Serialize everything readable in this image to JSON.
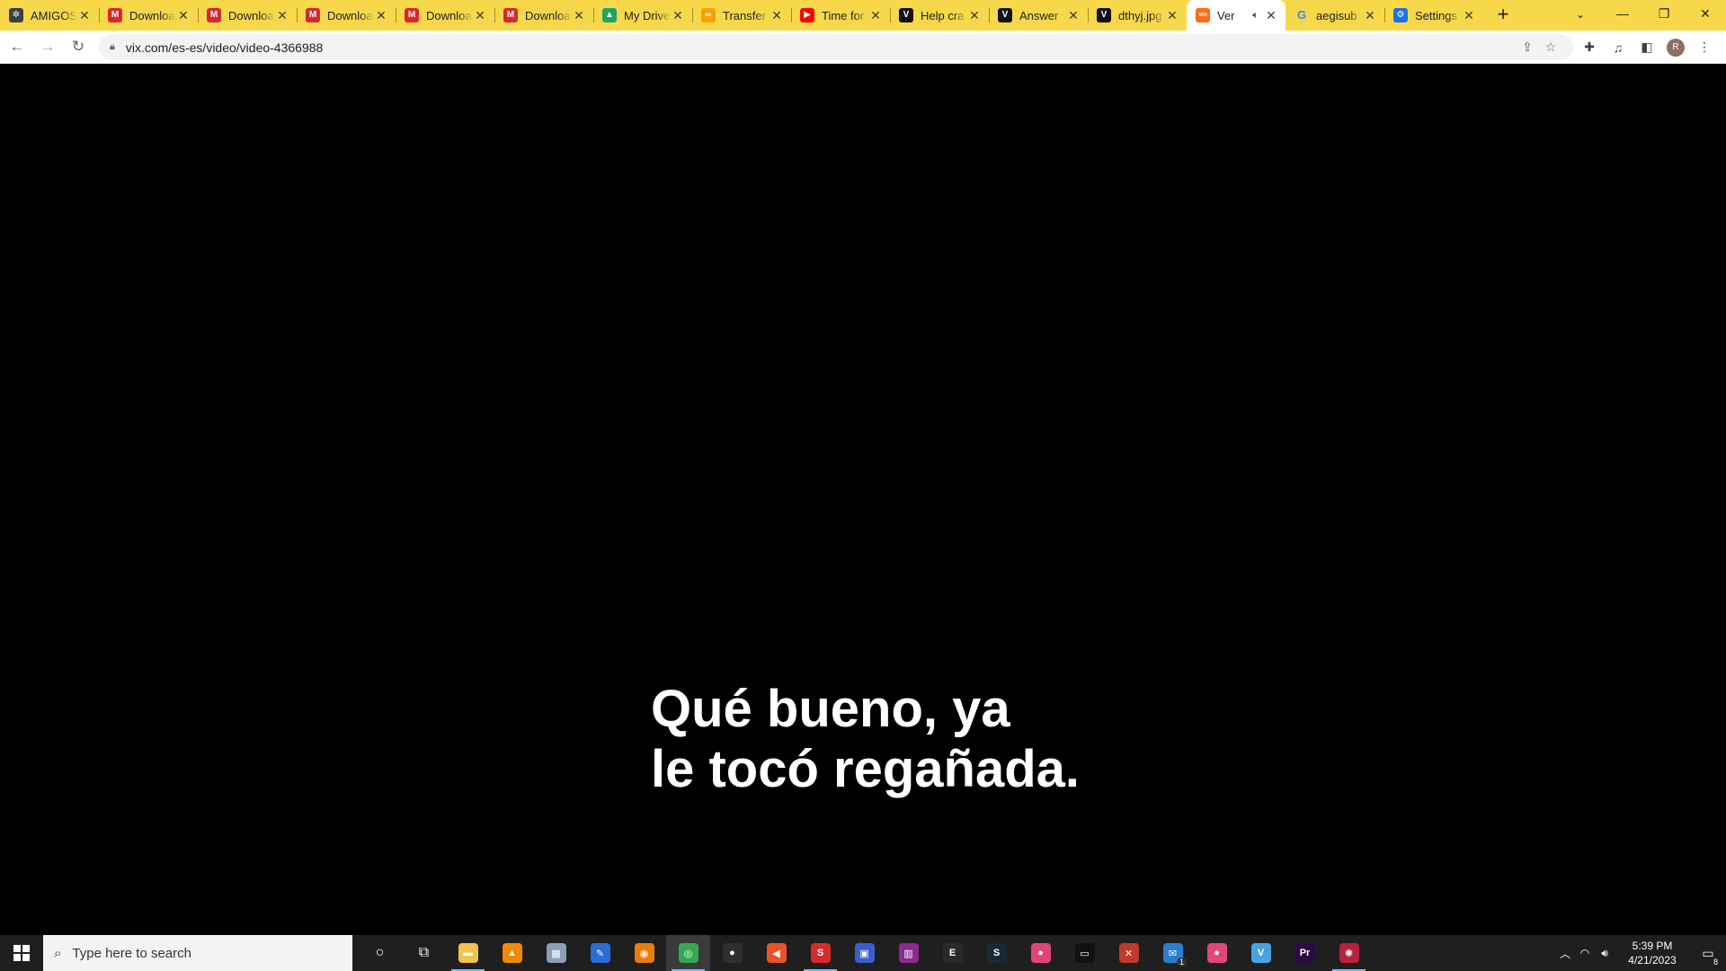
{
  "browser": {
    "tabs": [
      {
        "title": "AMIGOS",
        "favicon": "gear-dark-icon",
        "color": "#3c4043",
        "glyph": "✲",
        "active": false
      },
      {
        "title": "Downloa",
        "favicon": "mega-icon",
        "color": "#d9272e",
        "glyph": "M",
        "active": false
      },
      {
        "title": "Downloa",
        "favicon": "mega-icon",
        "color": "#d9272e",
        "glyph": "M",
        "active": false
      },
      {
        "title": "Downloa",
        "favicon": "mega-icon",
        "color": "#d9272e",
        "glyph": "M",
        "active": false
      },
      {
        "title": "Downloa",
        "favicon": "mega-icon",
        "color": "#d9272e",
        "glyph": "M",
        "active": false
      },
      {
        "title": "Downloa",
        "favicon": "mega-icon",
        "color": "#d9272e",
        "glyph": "M",
        "active": false
      },
      {
        "title": "My Drive",
        "favicon": "google-drive-icon",
        "color": "#1fa463",
        "glyph": "▲",
        "active": false
      },
      {
        "title": "Transfer",
        "favicon": "transfer-icon",
        "color": "#f4a300",
        "glyph": "∞",
        "active": false
      },
      {
        "title": "Time for",
        "favicon": "youtube-icon",
        "color": "#ff0000",
        "glyph": "▶",
        "active": false
      },
      {
        "title": "Help cra",
        "favicon": "v-icon",
        "color": "#111111",
        "glyph": "V",
        "active": false
      },
      {
        "title": "Answer",
        "favicon": "v-icon",
        "color": "#111111",
        "glyph": "V",
        "active": false
      },
      {
        "title": "dthyj.jpg",
        "favicon": "v-icon",
        "color": "#111111",
        "glyph": "V",
        "active": false
      },
      {
        "title": "Ver",
        "favicon": "vix-icon",
        "color": "#ff6a13",
        "glyph": "vix",
        "active": true,
        "audio": true
      },
      {
        "title": "aegisub",
        "favicon": "google-icon",
        "color": "#ffffff",
        "glyph": "G",
        "active": false
      },
      {
        "title": "Settings",
        "favicon": "settings-gear-icon",
        "color": "#1a73e8",
        "glyph": "⚙",
        "active": false
      }
    ],
    "url": "vix.com/es-es/video/video-4366988",
    "profile_initial": "R"
  },
  "content": {
    "subtitle_lines": [
      "Qué bueno, ya",
      "le tocó regañada."
    ]
  },
  "taskbar": {
    "search_placeholder": "Type here to search",
    "apps": [
      {
        "name": "cortana-icon",
        "color": "transparent",
        "glyph": "○",
        "running": false
      },
      {
        "name": "task-view-icon",
        "color": "transparent",
        "glyph": "⧉",
        "running": false
      },
      {
        "name": "file-explorer-icon",
        "color": "#f2c14e",
        "glyph": "▬",
        "running": true
      },
      {
        "name": "vlc-icon",
        "color": "#f08a00",
        "glyph": "▲",
        "running": false
      },
      {
        "name": "photos-icon",
        "color": "#8aa0b8",
        "glyph": "▦",
        "running": false
      },
      {
        "name": "paint-tool-icon",
        "color": "#2d6bd6",
        "glyph": "✎",
        "running": false
      },
      {
        "name": "blender-icon",
        "color": "#e87d0d",
        "glyph": "◉",
        "running": false
      },
      {
        "name": "chrome-icon",
        "color": "#34a853",
        "glyph": "◎",
        "running": true,
        "active": true
      },
      {
        "name": "obs-icon",
        "color": "#302e31",
        "glyph": "●",
        "running": false
      },
      {
        "name": "audio-app-icon",
        "color": "#e8542a",
        "glyph": "◀",
        "running": false
      },
      {
        "name": "subtitle-edit-icon",
        "color": "#d62b2b",
        "glyph": "S",
        "running": true
      },
      {
        "name": "monitor-app-icon",
        "color": "#3a5fcd",
        "glyph": "▣",
        "running": false
      },
      {
        "name": "winrar-icon",
        "color": "#8b2a8f",
        "glyph": "▥",
        "running": false
      },
      {
        "name": "epic-games-icon",
        "color": "#2a2a2a",
        "glyph": "E",
        "running": false
      },
      {
        "name": "steam-icon",
        "color": "#1b2838",
        "glyph": "S",
        "running": false
      },
      {
        "name": "pink-app-icon",
        "color": "#e0457b",
        "glyph": "●",
        "running": false
      },
      {
        "name": "terminal-icon",
        "color": "#111111",
        "glyph": "▭",
        "running": false
      },
      {
        "name": "game-app-icon",
        "color": "#c0392b",
        "glyph": "✕",
        "running": false
      },
      {
        "name": "mail-icon",
        "color": "#2b7cd3",
        "glyph": "✉",
        "running": false
      },
      {
        "name": "pink-app-2-icon",
        "color": "#e0457b",
        "glyph": "●",
        "running": false
      },
      {
        "name": "vegas-icon",
        "color": "#4aa3df",
        "glyph": "V",
        "running": false
      },
      {
        "name": "premiere-pro-icon",
        "color": "#2a0a45",
        "glyph": "Pr",
        "running": false
      },
      {
        "name": "davinci-icon",
        "color": "#b5243a",
        "glyph": "✺",
        "running": true
      }
    ],
    "time": "5:39 PM",
    "date": "4/21/2023",
    "mail_badge": "1",
    "notification_badge": "8"
  }
}
